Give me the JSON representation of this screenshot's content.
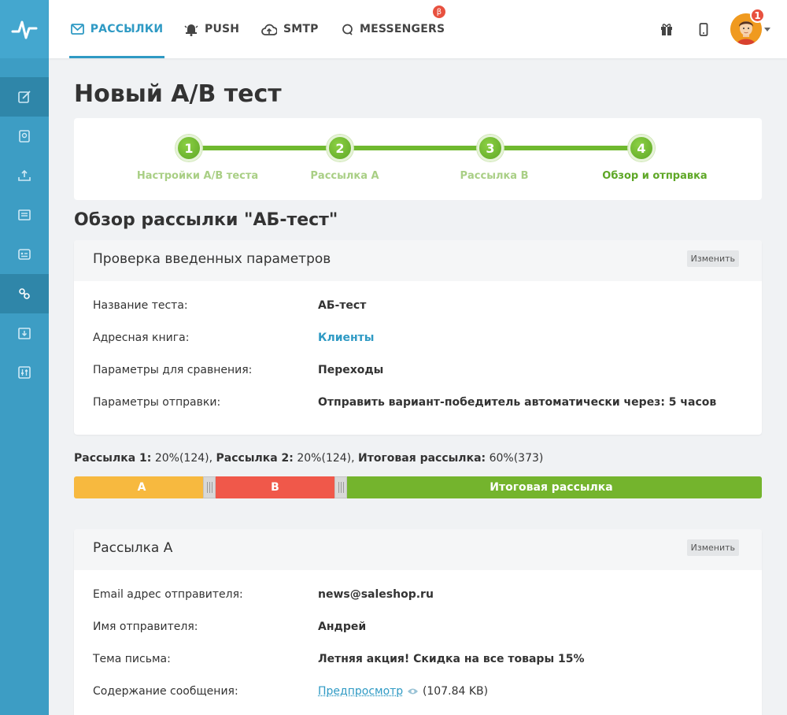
{
  "nav": {
    "tabs": [
      {
        "label": "РАССЫЛКИ",
        "icon": "mail-icon"
      },
      {
        "label": "PUSH",
        "icon": "bell-icon"
      },
      {
        "label": "SMTP",
        "icon": "cloud-upload-icon"
      },
      {
        "label": "MESSENGERS",
        "icon": "chat-icon"
      }
    ],
    "beta_badge": "β",
    "notifications_count": "1"
  },
  "sidebar": {
    "items": [
      "edit-icon",
      "contacts-icon",
      "upload-icon",
      "template-icon",
      "automation-icon",
      "ab-test-icon",
      "archive-icon",
      "settings-icon"
    ]
  },
  "page": {
    "title": "Новый A/B тест"
  },
  "steps": [
    {
      "number": "1",
      "label": "Настройки A/B теста"
    },
    {
      "number": "2",
      "label": "Рассылка А"
    },
    {
      "number": "3",
      "label": "Рассылка В"
    },
    {
      "number": "4",
      "label": "Обзор и отправка"
    }
  ],
  "overview": {
    "title": "Обзор рассылки \"АБ-тест\""
  },
  "params_card": {
    "title": "Проверка введенных параметров",
    "edit_label": "Изменить",
    "rows": [
      {
        "label": "Название теста:",
        "value": "АБ-тест"
      },
      {
        "label": "Адресная книга:",
        "value": "Клиенты"
      },
      {
        "label": "Параметры для сравнения:",
        "value": "Переходы"
      },
      {
        "label": "Параметры отправки:",
        "value": "Отправить вариант-победитель автоматически через: 5 часов"
      }
    ]
  },
  "split": {
    "s1_label": "Рассылка 1:",
    "s1_value": "20%(124)",
    "s2_label": "Рассылка 2:",
    "s2_value": "20%(124)",
    "final_label": "Итоговая рассылка:",
    "final_value": "60%(373)",
    "separator": ",",
    "bar_a": "A",
    "bar_b": "B",
    "bar_final": "Итоговая рассылка"
  },
  "mail_a_card": {
    "title": "Рассылка А",
    "edit_label": "Изменить",
    "rows": [
      {
        "label": "Email адрес отправителя:",
        "value": "news@saleshop.ru"
      },
      {
        "label": "Имя отправителя:",
        "value": "Андрей"
      },
      {
        "label": "Тема письма:",
        "value": "Летняя акция! Скидка на все товары 15%"
      },
      {
        "label": "Содержание сообщения:",
        "value": "Предпросмотр",
        "size": "(107.84 KB)"
      }
    ]
  }
}
